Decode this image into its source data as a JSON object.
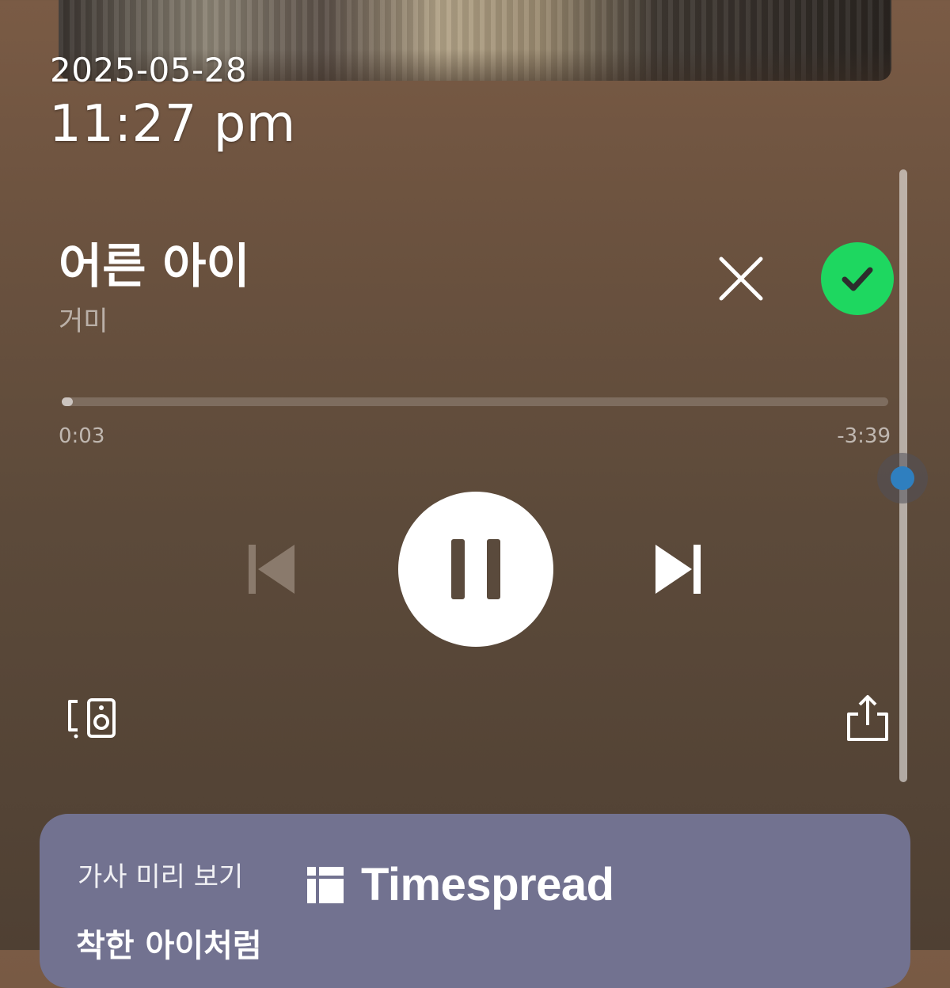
{
  "status": {
    "date": "2025-05-28",
    "time": "11:27 pm"
  },
  "track": {
    "title": "어른 아이",
    "artist": "거미"
  },
  "progress": {
    "elapsed": "0:03",
    "remaining": "-3:39",
    "fraction": 0.0135
  },
  "icons": {
    "dismiss": "close-icon",
    "added": "check-icon",
    "previous": "skip-previous-icon",
    "play_pause": "pause-icon",
    "next": "skip-next-icon",
    "devices": "connect-device-icon",
    "share": "share-icon",
    "brand": "timespread-logo-icon"
  },
  "colors": {
    "accent_green": "#1ed760",
    "lyrics_panel": "#727290",
    "scroll_thumb": "#2f7fbf"
  },
  "lyrics": {
    "heading": "가사 미리 보기",
    "first_line": "착한 아이처럼"
  },
  "watermark": {
    "brand": "Timespread"
  }
}
